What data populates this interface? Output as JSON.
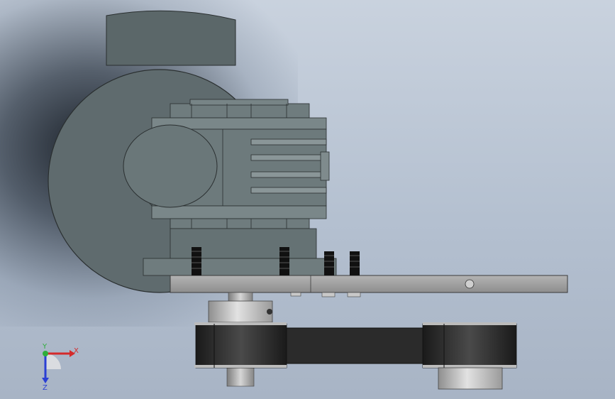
{
  "triad": {
    "x_label": "X",
    "y_label": "Y",
    "z_label": "Z",
    "colors": {
      "x": "#d42a2a",
      "y": "#2fae3a",
      "z": "#2a3fd4"
    }
  },
  "colors": {
    "motor_body": "#5f6b6e",
    "gearbox": "#6d7a7c",
    "plate": "#9a9a9a",
    "pulley": "#bdbdbd",
    "belt": "#2b2b2b",
    "screw": "#111111"
  }
}
